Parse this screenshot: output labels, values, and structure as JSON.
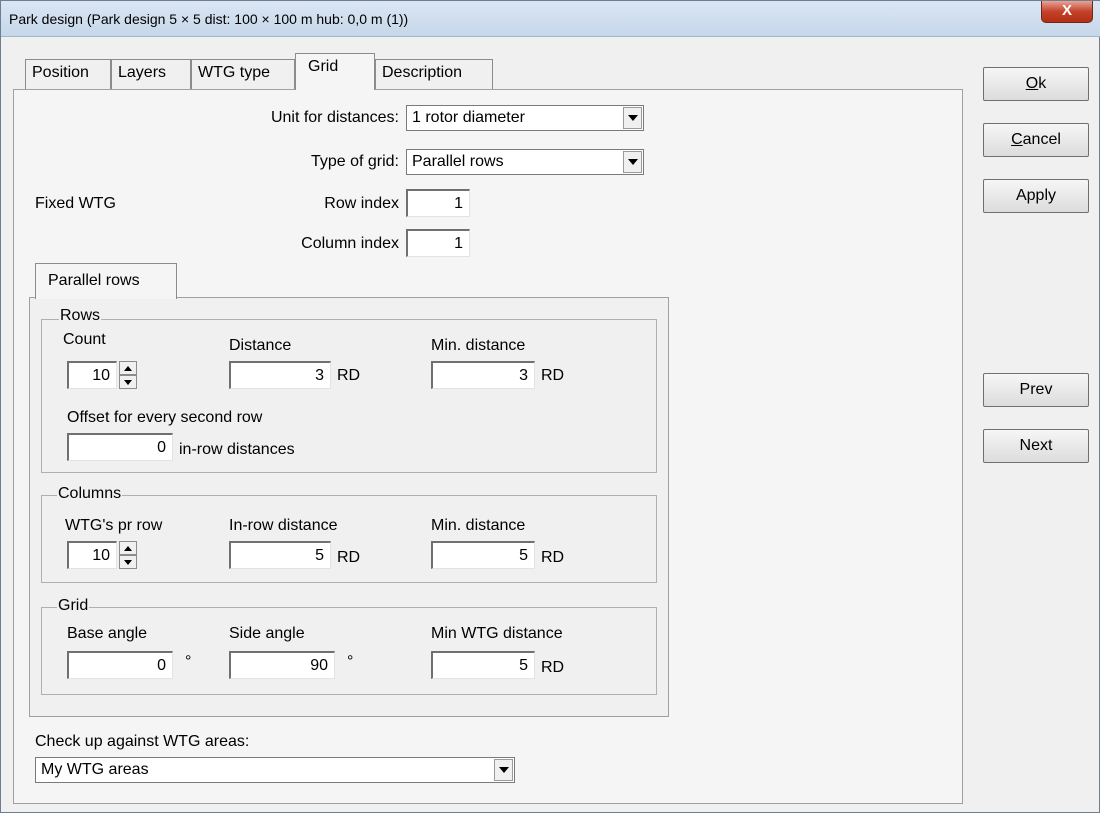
{
  "window": {
    "title": "Park design   (Park design 5 × 5   dist: 100 × 100 m  hub: 0,0 m (1))",
    "close_label": "X"
  },
  "tabs": [
    {
      "label": "Position"
    },
    {
      "label": "Layers"
    },
    {
      "label": "WTG type"
    },
    {
      "label": "Grid",
      "active": true
    },
    {
      "label": "Description"
    }
  ],
  "top": {
    "unit_label": "Unit for distances:",
    "unit_value": "1 rotor diameter",
    "grid_type_label": "Type of grid:",
    "grid_type_value": "Parallel rows",
    "fixed_wtg_label": "Fixed WTG",
    "row_index_label": "Row index",
    "row_index_value": "1",
    "column_index_label": "Column index",
    "column_index_value": "1"
  },
  "inner_tab": {
    "label": "Parallel rows"
  },
  "rows_group": {
    "title": "Rows",
    "count_label": "Count",
    "count_value": "10",
    "distance_label": "Distance",
    "distance_value": "3",
    "distance_unit": "RD",
    "min_distance_label": "Min. distance",
    "min_distance_value": "3",
    "min_distance_unit": "RD",
    "offset_label": "Offset for every second row",
    "offset_value": "0",
    "offset_unit": "in-row distances"
  },
  "columns_group": {
    "title": "Columns",
    "wtgs_label": "WTG's pr row",
    "wtgs_value": "10",
    "inrow_label": "In-row distance",
    "inrow_value": "5",
    "inrow_unit": "RD",
    "min_distance_label": "Min. distance",
    "min_distance_value": "5",
    "min_distance_unit": "RD"
  },
  "grid_group": {
    "title": "Grid",
    "base_angle_label": "Base angle",
    "base_angle_value": "0",
    "base_angle_unit": "°",
    "side_angle_label": "Side angle",
    "side_angle_value": "90",
    "side_angle_unit": "°",
    "min_wtg_label": "Min WTG distance",
    "min_wtg_value": "5",
    "min_wtg_unit": "RD"
  },
  "bottom": {
    "check_label": "Check up against WTG areas:",
    "check_value": "My WTG areas"
  },
  "buttons": {
    "ok_prefix": "O",
    "ok_rest": "k",
    "cancel_prefix": "C",
    "cancel_rest": "ancel",
    "apply": "Apply",
    "prev": "Prev",
    "next": "Next"
  }
}
